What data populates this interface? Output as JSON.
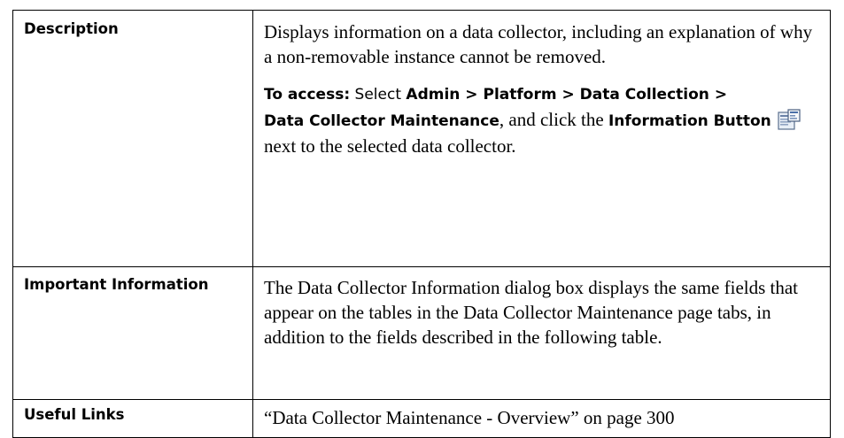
{
  "rows": {
    "description": {
      "label": "Description",
      "text": "Displays information on a data collector, including an explanation of why a non-removable instance cannot be removed.",
      "access": {
        "prefix": "To access:",
        "t1": " Select ",
        "admin": "Admin",
        "sep1": " > ",
        "platform": "Platform",
        "sep2": " > ",
        "data_collection": "Data Collection",
        "sep3": " > ",
        "dc_maintenance": "Data Collector Maintenance",
        "t2": ", and click the ",
        "info_button": "Information Button",
        "t3": " next to the selected data collector.",
        "icon": "information-button-icon"
      }
    },
    "important": {
      "label": "Important Information",
      "text": "The Data Collector Information dialog box displays the same fields that appear on the tables in the Data Collector Maintenance page tabs, in addition to the fields described in the following table."
    },
    "links": {
      "label": "Useful Links",
      "link_text": "“Data Collector Maintenance - Overview” on page 300"
    }
  }
}
